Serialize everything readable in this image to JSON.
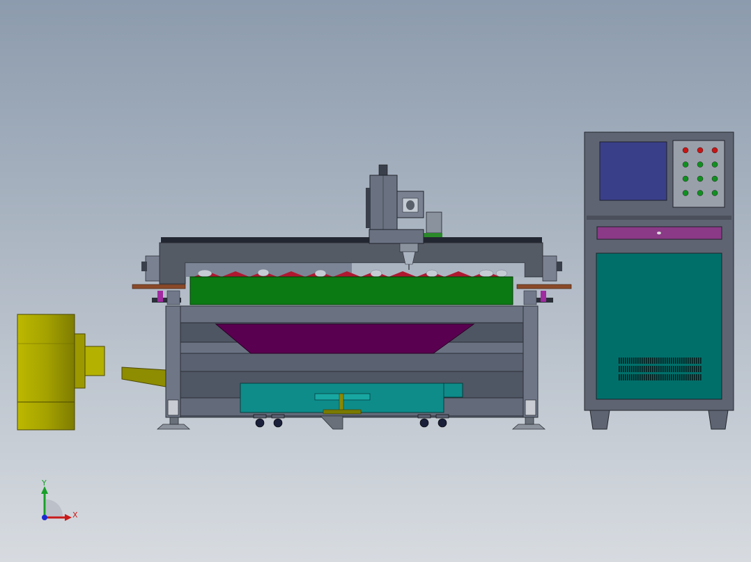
{
  "scene": {
    "background_top": "#8c9bad",
    "background_bottom": "#d7dbe0"
  },
  "colors": {
    "frame_gray": "#5d6575",
    "frame_dark": "#3a404b",
    "gantry": "#555b65",
    "bed_green": "#0b7a12",
    "hopper_purple": "#5a0050",
    "tray_teal": "#0d8c8a",
    "cabinet_gray": "#5f6472",
    "cabinet_teal": "#006f6a",
    "screen_blue": "#3a3f8a",
    "panel_purple": "#8a3a87",
    "blower_olive": "#a2a000",
    "plate_brown": "#8a4a2a",
    "led_red": "#c81414",
    "led_green": "#109020"
  },
  "axis_triad": {
    "x_label": "X",
    "y_label": "Y",
    "x_color": "#c81a1a",
    "y_color": "#18a028",
    "z_color": "#1a2ad0"
  },
  "control_panel": {
    "led_rows": [
      [
        "red",
        "red",
        "red"
      ],
      [
        "green",
        "green",
        "green"
      ],
      [
        "green",
        "green",
        "green"
      ],
      [
        "green",
        "green",
        "green"
      ]
    ]
  }
}
